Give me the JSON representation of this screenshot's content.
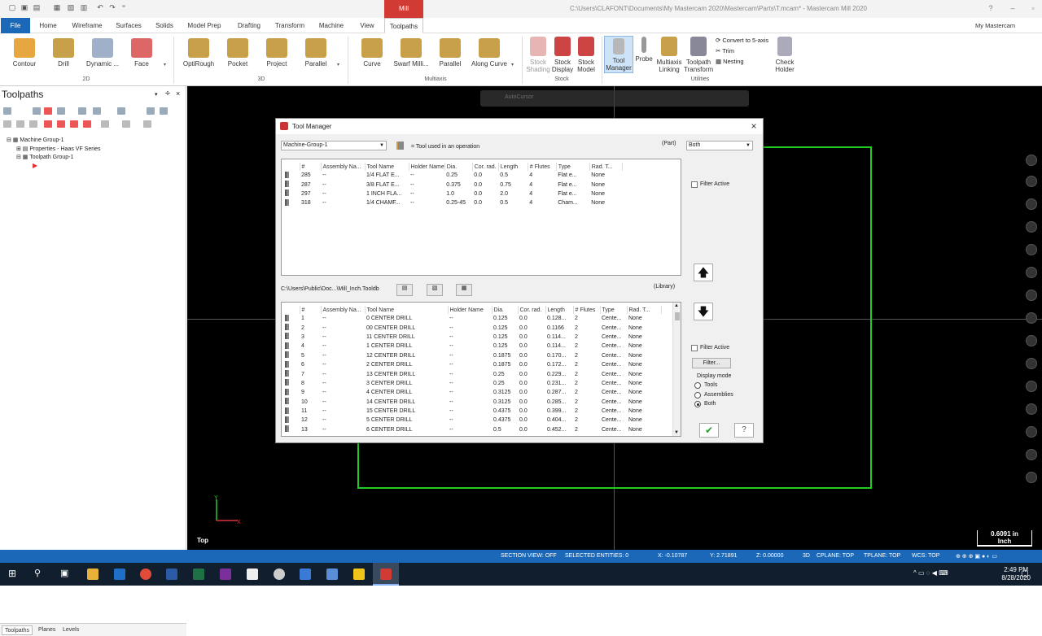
{
  "window": {
    "title": "C:\\Users\\CLAFONT\\Documents\\My Mastercam 2020\\Mastercam\\Parts\\T.mcam* - Mastercam Mill 2020",
    "context_tab": "Mill"
  },
  "tabs": [
    "File",
    "Home",
    "Wireframe",
    "Surfaces",
    "Solids",
    "Model Prep",
    "Drafting",
    "Transform",
    "Machine",
    "View",
    "Toolpaths"
  ],
  "account": "My Mastercam",
  "ribbon": {
    "groups": {
      "g2d": "2D",
      "g3d": "3D",
      "multiaxis": "Multiaxis",
      "stock": "Stock",
      "utilities": "Utilities"
    },
    "b2d": [
      "Contour",
      "Drill",
      "Dynamic ...",
      "Face"
    ],
    "b3d": [
      "OptiRough",
      "Pocket",
      "Project",
      "Parallel"
    ],
    "bmulti": [
      "Curve",
      "Swarf Milli...",
      "Parallel",
      "Along Curve"
    ],
    "stock": {
      "shading": "Stock Shading",
      "display": "Stock Display",
      "model": "Stock Model"
    },
    "utilities": {
      "tool_manager": "Tool Manager",
      "probe": "Probe",
      "multiaxis_linking": "Multiaxis Linking",
      "toolpath_transform": "Toolpath Transform",
      "convert": "Convert to 5-axis",
      "trim": "Trim",
      "nesting": "Nesting",
      "check_holder": "Check Holder"
    }
  },
  "toolpaths_panel": {
    "title": "Toolpaths",
    "tree": [
      "Machine Group-1",
      "Properties - Haas VF Series",
      "Toolpath Group-1"
    ],
    "bottom_tabs": [
      "Toolpaths",
      "Planes",
      "Levels"
    ]
  },
  "viewport": {
    "view_label": "Top",
    "scale_value": "0.6091 in",
    "scale_unit": "Inch",
    "topbar_text": "AutoCursor"
  },
  "status": {
    "section_view": "SECTION VIEW: OFF",
    "selected": "SELECTED ENTITIES: 0",
    "x": "X:   -0.10787",
    "y": "Y:   2.71891",
    "z": "Z:   0.00000",
    "mode": "3D",
    "cplane": "CPLANE: TOP",
    "tplane": "TPLANE: TOP",
    "wcs": "WCS: TOP"
  },
  "clock": {
    "time": "2:49 PM",
    "date": "8/28/2020"
  },
  "dialog": {
    "title": "Tool Manager",
    "machine_group": "Machine-Group-1",
    "legend": "= Tool used in an operation",
    "part_label": "(Part)",
    "filter_select": "Both",
    "library_path": "C:\\Users\\Public\\Doc...\\Mill_Inch.Tooldb",
    "library_label": "(Library)",
    "filter_active": "Filter Active",
    "filter_button": "Filter...",
    "display_mode": "Display mode",
    "mode_tools": "Tools",
    "mode_assemblies": "Assemblies",
    "mode_both": "Both",
    "columns": [
      "#",
      "Assembly Na...",
      "Tool Name",
      "Holder Name",
      "Dia.",
      "Cor. rad.",
      "Length",
      "# Flutes",
      "Type",
      "Rad. T..."
    ],
    "part_tools": [
      [
        "285",
        "--",
        "1/4 FLAT E...",
        "--",
        "0.25",
        "0.0",
        "0.5",
        "4",
        "Flat e...",
        "None"
      ],
      [
        "287",
        "--",
        "3/8 FLAT E...",
        "--",
        "0.375",
        "0.0",
        "0.75",
        "4",
        "Flat e...",
        "None"
      ],
      [
        "297",
        "--",
        "1 INCH FLA...",
        "--",
        "1.0",
        "0.0",
        "2.0",
        "4",
        "Flat e...",
        "None"
      ],
      [
        "318",
        "--",
        "1/4 CHAMF...",
        "--",
        "0.25-45",
        "0.0",
        "0.5",
        "4",
        "Cham...",
        "None"
      ]
    ],
    "library_tools": [
      [
        "1",
        "--",
        "0 CENTER DRILL",
        "--",
        "0.125",
        "0.0",
        "0.128...",
        "2",
        "Cente...",
        "None"
      ],
      [
        "2",
        "--",
        "00 CENTER DRILL",
        "--",
        "0.125",
        "0.0",
        "0.1166",
        "2",
        "Cente...",
        "None"
      ],
      [
        "3",
        "--",
        "11 CENTER DRILL",
        "--",
        "0.125",
        "0.0",
        "0.114...",
        "2",
        "Cente...",
        "None"
      ],
      [
        "4",
        "--",
        "1 CENTER DRILL",
        "--",
        "0.125",
        "0.0",
        "0.114...",
        "2",
        "Cente...",
        "None"
      ],
      [
        "5",
        "--",
        "12 CENTER DRILL",
        "--",
        "0.1875",
        "0.0",
        "0.170...",
        "2",
        "Cente...",
        "None"
      ],
      [
        "6",
        "--",
        "2 CENTER DRILL",
        "--",
        "0.1875",
        "0.0",
        "0.172...",
        "2",
        "Cente...",
        "None"
      ],
      [
        "7",
        "--",
        "13 CENTER DRILL",
        "--",
        "0.25",
        "0.0",
        "0.229...",
        "2",
        "Cente...",
        "None"
      ],
      [
        "8",
        "--",
        "3 CENTER DRILL",
        "--",
        "0.25",
        "0.0",
        "0.231...",
        "2",
        "Cente...",
        "None"
      ],
      [
        "9",
        "--",
        "4 CENTER DRILL",
        "--",
        "0.3125",
        "0.0",
        "0.287...",
        "2",
        "Cente...",
        "None"
      ],
      [
        "10",
        "--",
        "14 CENTER DRILL",
        "--",
        "0.3125",
        "0.0",
        "0.285...",
        "2",
        "Cente...",
        "None"
      ],
      [
        "11",
        "--",
        "15 CENTER DRILL",
        "--",
        "0.4375",
        "0.0",
        "0.399...",
        "2",
        "Cente...",
        "None"
      ],
      [
        "12",
        "--",
        "5 CENTER DRILL",
        "--",
        "0.4375",
        "0.0",
        "0.404...",
        "2",
        "Cente...",
        "None"
      ],
      [
        "13",
        "--",
        "6 CENTER DRILL",
        "--",
        "0.5",
        "0.0",
        "0.452...",
        "2",
        "Cente...",
        "None"
      ]
    ]
  },
  "colors": {
    "accent": "#1a68b7",
    "mill_tab": "#d23a34",
    "geometry": "#22cc22",
    "viewport": "#000000"
  }
}
